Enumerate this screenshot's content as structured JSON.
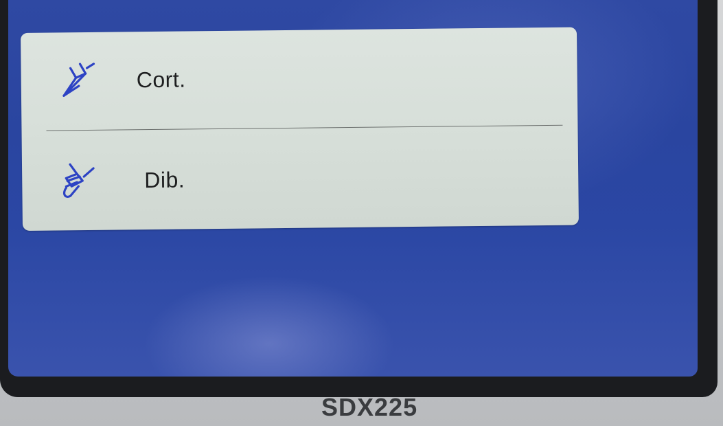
{
  "menu": {
    "items": [
      {
        "label": "Cort.",
        "icon": "cutting-blade-icon"
      },
      {
        "label": "Dib.",
        "icon": "drawing-pen-icon"
      }
    ]
  },
  "device": {
    "model": "SDX225"
  },
  "colors": {
    "screen_background": "#2b47a4",
    "menu_panel": "#d7dfd9",
    "icon_blue": "#2d43c4",
    "bezel": "#1b1c1f"
  }
}
